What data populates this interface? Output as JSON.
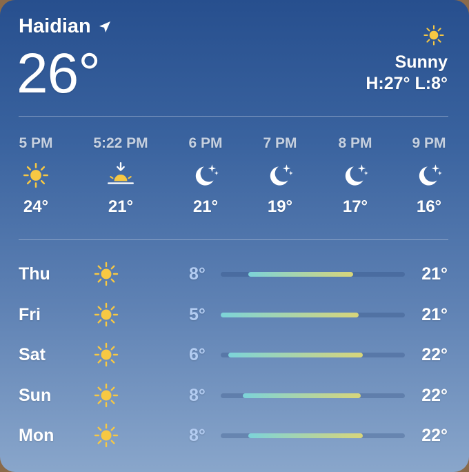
{
  "current": {
    "location": "Haidian",
    "temp": "26°",
    "condition": "Sunny",
    "hilo": "H:27° L:8°",
    "icon": "sun-icon"
  },
  "hourly": [
    {
      "time": "5 PM",
      "icon": "sun-icon",
      "temp": "24°"
    },
    {
      "time": "5:22 PM",
      "icon": "sunset-icon",
      "temp": "21°"
    },
    {
      "time": "6 PM",
      "icon": "moon-stars-icon",
      "temp": "21°"
    },
    {
      "time": "7 PM",
      "icon": "moon-stars-icon",
      "temp": "19°"
    },
    {
      "time": "8 PM",
      "icon": "moon-stars-icon",
      "temp": "17°"
    },
    {
      "time": "9 PM",
      "icon": "moon-stars-icon",
      "temp": "16°"
    }
  ],
  "daily": [
    {
      "day": "Thu",
      "icon": "sun-icon",
      "low": "8°",
      "high": "21°",
      "range_start": 0.15,
      "range_end": 0.72
    },
    {
      "day": "Fri",
      "icon": "sun-icon",
      "low": "5°",
      "high": "21°",
      "range_start": 0.0,
      "range_end": 0.75
    },
    {
      "day": "Sat",
      "icon": "sun-icon",
      "low": "6°",
      "high": "22°",
      "range_start": 0.04,
      "range_end": 0.77
    },
    {
      "day": "Sun",
      "icon": "sun-icon",
      "low": "8°",
      "high": "22°",
      "range_start": 0.12,
      "range_end": 0.76
    },
    {
      "day": "Mon",
      "icon": "sun-icon",
      "low": "8°",
      "high": "22°",
      "range_start": 0.15,
      "range_end": 0.77
    }
  ],
  "colors": {
    "sun": "#f7c843",
    "low_temp": "#b3ccf1",
    "bar_start": "#7cd3d9",
    "bar_end": "#d8d57a"
  }
}
